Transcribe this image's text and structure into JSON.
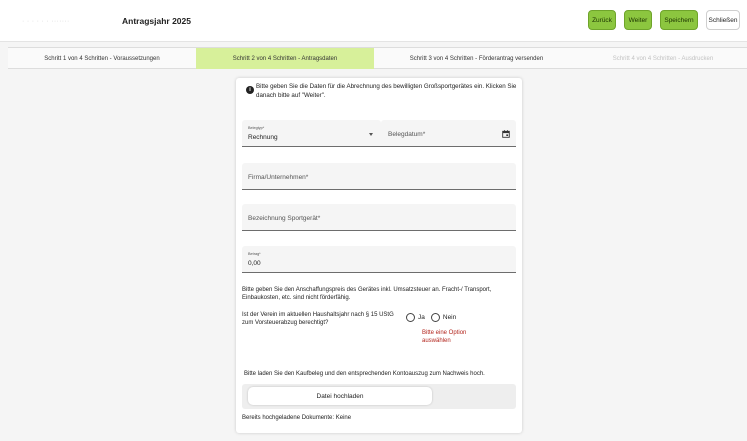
{
  "header": {
    "breadcrumb_faded": "· · · · ·  ·  ·······",
    "title": "Antragsjahr 2025",
    "buttons": {
      "back": "Zurück",
      "next": "Weiter",
      "save": "Speichern",
      "close": "Schließen"
    }
  },
  "steps": [
    {
      "label": "Schritt 1 von 4 Schritten - Voraussetzungen",
      "state": "done"
    },
    {
      "label": "Schritt 2 von 4 Schritten - Antragsdaten",
      "state": "active"
    },
    {
      "label": "Schritt 3 von 4 Schritten - Förderantrag versenden",
      "state": "pending"
    },
    {
      "label": "Schritt 4 von 4 Schritten - Ausdrucken",
      "state": "disabled"
    }
  ],
  "form": {
    "info": "Bitte geben Sie die Daten für die Abrechnung des bewilligten Großsportgerätes ein. Klicken Sie danach bitte auf \"Weiter\".",
    "belegtyp": {
      "label": "Belegtyp*",
      "value": "Rechnung"
    },
    "belegdatum": {
      "placeholder": "Belegdatum*"
    },
    "firma": {
      "placeholder": "Firma/Unternehmen*"
    },
    "sportgeraet": {
      "placeholder": "Bezeichnung Sportgerät*"
    },
    "betrag": {
      "label": "Betrag*",
      "value": "0,00"
    },
    "price_hint": "Bitte geben Sie den Anschaffungspreis des Gerätes inkl. Umsatzsteuer an. Fracht-/ Transport, Einbaukosten, etc. sind nicht förderfähig.",
    "vat_question": "Ist der Verein im aktuellen Haushaltsjahr nach § 15 UStG zum Vorsteuerabzug berechtigt?",
    "radio_yes": "Ja",
    "radio_no": "Nein",
    "radio_error": "Bitte eine Option auswählen",
    "upload_hint": "Bitte laden Sie den Kaufbeleg und den entsprechenden Kontoauszug zum Nachweis hoch.",
    "upload_button": "Datei hochladen",
    "uploaded_docs": "Bereits hochgeladene Dokumente: Keine"
  },
  "colors": {
    "accent_green": "#8cc63f",
    "active_step": "#d7f09a",
    "error_red": "#b3261e"
  }
}
